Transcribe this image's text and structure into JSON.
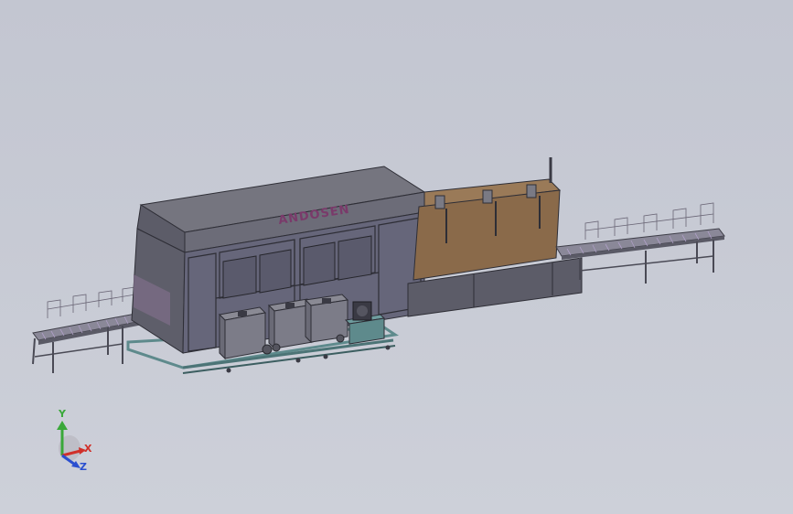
{
  "model": {
    "brand_label": "ANDOSEN"
  },
  "triad": {
    "x_label": "X",
    "y_label": "Y",
    "z_label": "Z",
    "x_color": "#d0302a",
    "y_color": "#3aa83a",
    "z_color": "#2a4fd0"
  },
  "colors": {
    "housing": "#6a6a7a",
    "housing_top": "#75757f",
    "oven": "#8a6a4a",
    "frame_teal": "#5e8a8c",
    "conveyor_roller": "#b0a0c8"
  }
}
